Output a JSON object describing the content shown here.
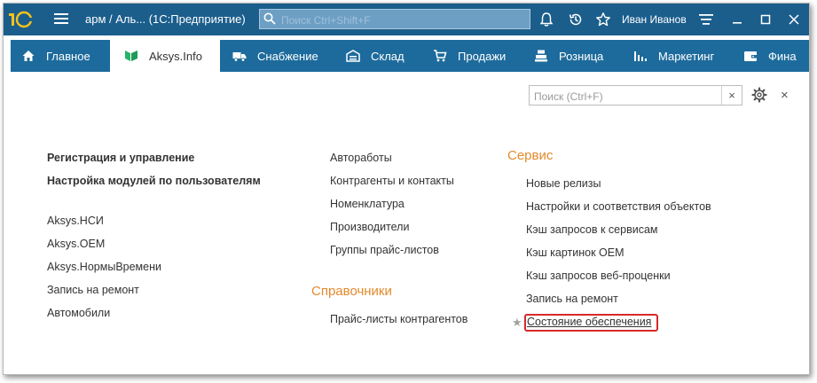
{
  "window": {
    "logo_text": "1С",
    "title": "арм / Аль...  (1С:Предприятие)",
    "search_placeholder": "Поиск Ctrl+Shift+F",
    "user_name": "Иван Иванов"
  },
  "menu": {
    "tabs": [
      {
        "label": "Главное",
        "icon": "home-icon"
      },
      {
        "label": "Aksys.Info",
        "icon": "aksys-logo-icon"
      },
      {
        "label": "Снабжение",
        "icon": "truck-icon"
      },
      {
        "label": "Склад",
        "icon": "warehouse-icon"
      },
      {
        "label": "Продажи",
        "icon": "cart-icon"
      },
      {
        "label": "Розница",
        "icon": "cash-register-icon"
      },
      {
        "label": "Маркетинг",
        "icon": "bar-chart-icon"
      },
      {
        "label": "Фина",
        "icon": "wallet-icon"
      }
    ]
  },
  "content": {
    "search_placeholder": "Поиск (Ctrl+F)",
    "clear_label": "×",
    "close_label": "×",
    "col1": {
      "bold_items": [
        "Регистрация и управление",
        "Настройка модулей по пользователям"
      ],
      "items": [
        "Aksys.НСИ",
        "Aksys.OEM",
        "Aksys.НормыВремени",
        "Запись на ремонт",
        "Автомобили"
      ]
    },
    "col2": {
      "items": [
        "Автоработы",
        "Контрагенты и контакты",
        "Номенклатура",
        "Производители",
        "Группы прайс-листов"
      ],
      "section_title": "Справочники",
      "section_items": [
        "Прайс-листы контрагентов"
      ]
    },
    "col3": {
      "section_title": "Сервис",
      "items": [
        "Новые релизы",
        "Настройки и соответствия объектов",
        "Кэш запросов к сервисам",
        "Кэш картинок OEM",
        "Кэш запросов веб-проценки",
        "Запись на ремонт",
        "Состояние обеспечения"
      ]
    },
    "star": "★"
  },
  "colors": {
    "titlebar": "#1b5e8c",
    "menubar": "#1d6b9c",
    "section": "#e38a2c",
    "highlight": "#d62a2a"
  }
}
